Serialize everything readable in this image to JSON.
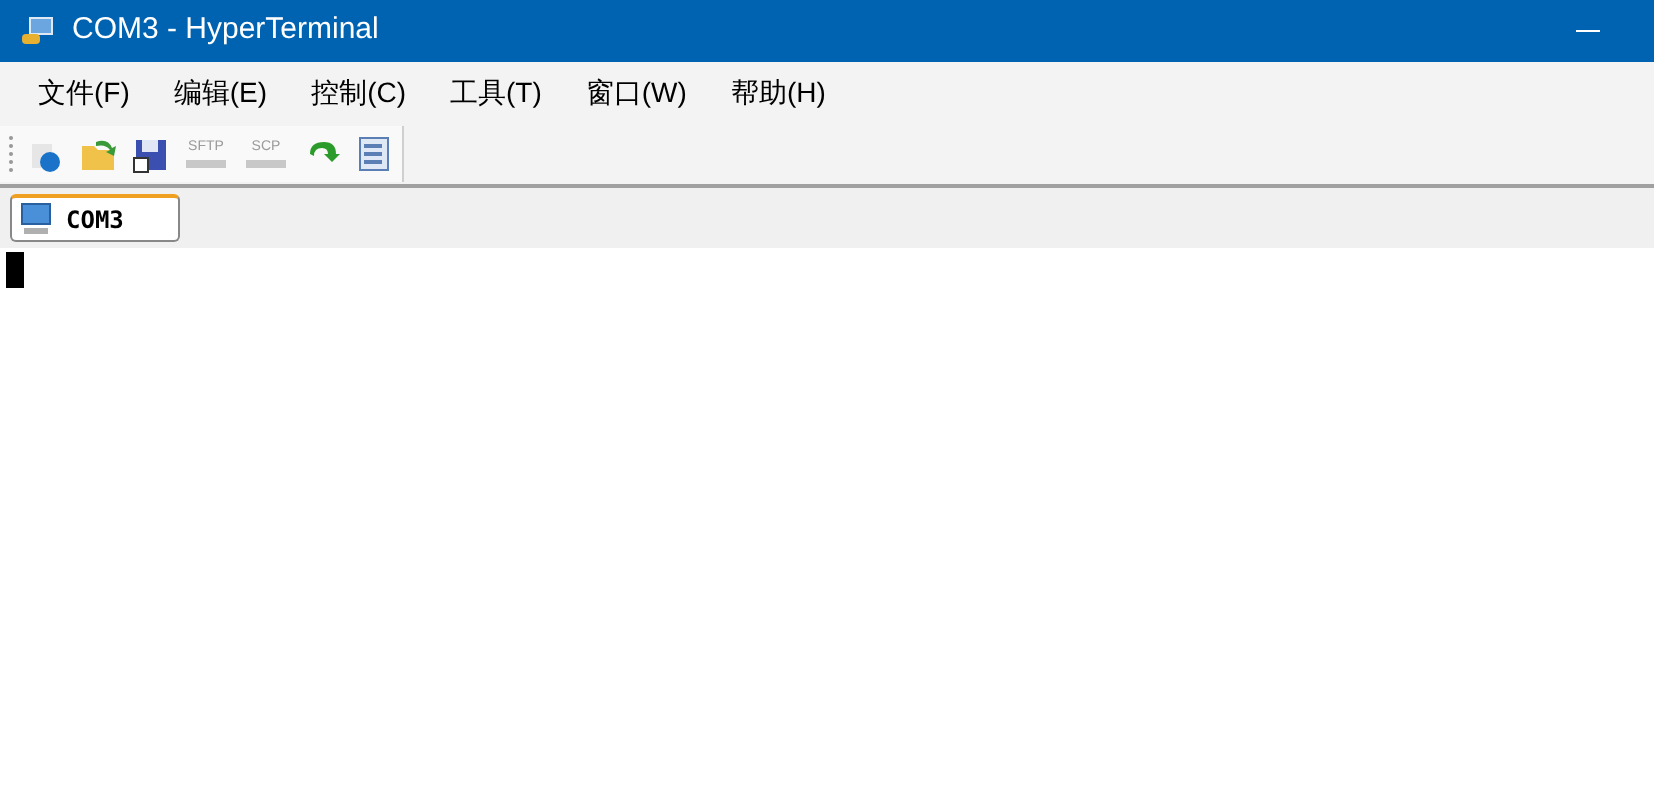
{
  "window": {
    "title": "COM3 - HyperTerminal"
  },
  "menu": [
    "文件(F)",
    "编辑(E)",
    "控制(C)",
    "工具(T)",
    "窗口(W)",
    "帮助(H)"
  ],
  "toolbar": [
    {
      "label": "SFTP",
      "disabled": true
    },
    {
      "label": "SCP",
      "disabled": true
    }
  ],
  "tabs": [
    {
      "label": "COM3",
      "selected": true
    }
  ]
}
